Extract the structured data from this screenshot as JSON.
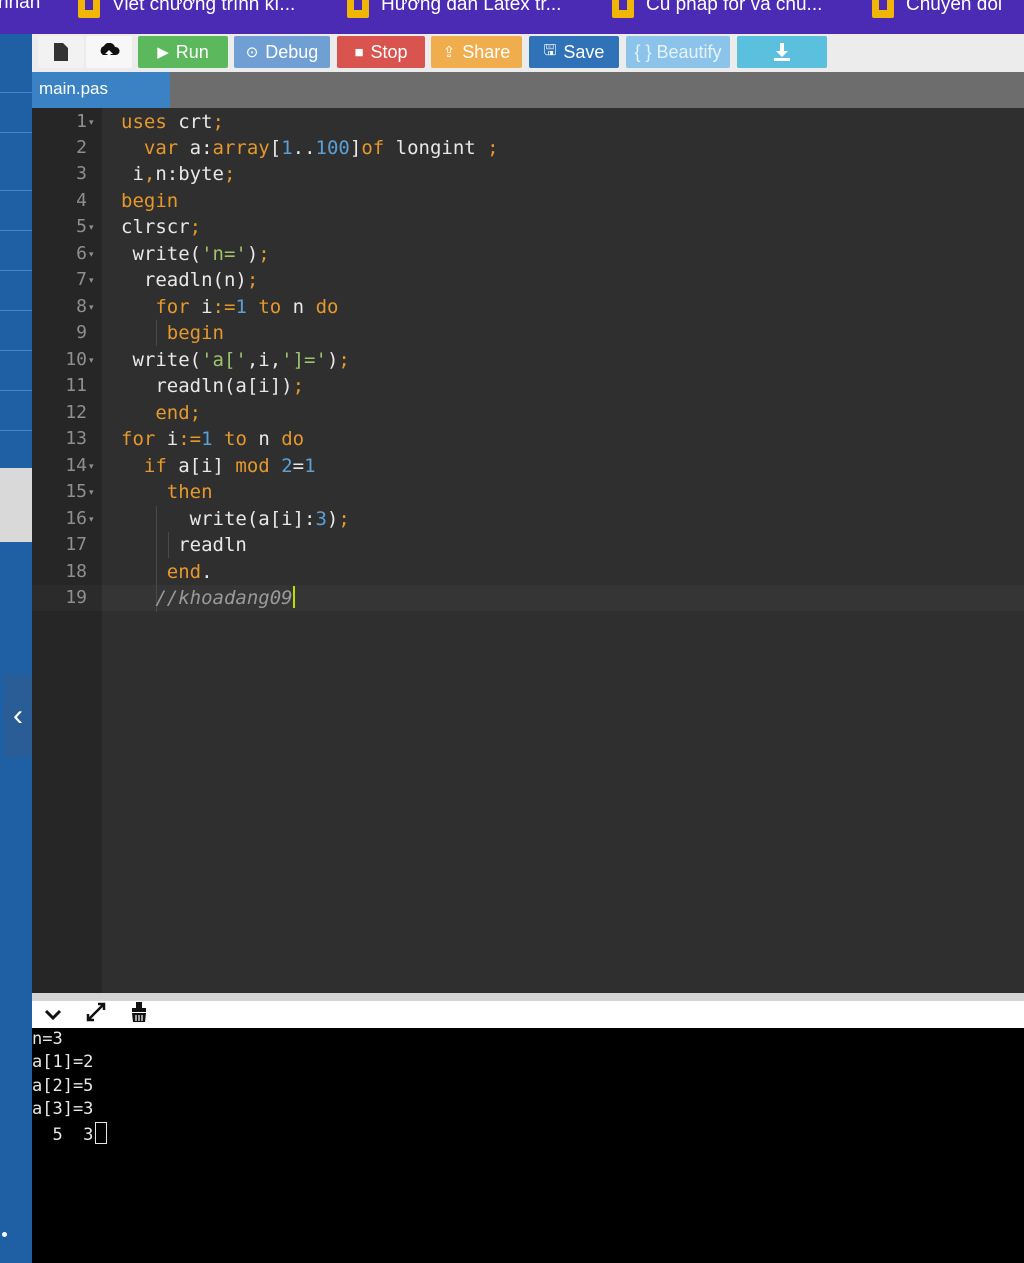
{
  "bookmarks": [
    {
      "label": "nhan"
    },
    {
      "label": "Viết chương trình kí..."
    },
    {
      "label": "Hướng dẫn Latex tr..."
    },
    {
      "label": "Cú pháp for và chu..."
    },
    {
      "label": "Chuyển đổi"
    }
  ],
  "toolbar": {
    "new_icon": "file-icon",
    "upload_icon": "upload-cloud-icon",
    "run_label": "Run",
    "debug_label": "Debug",
    "stop_label": "Stop",
    "share_label": "Share",
    "save_label": "Save",
    "beautify_label": "{ } Beautify",
    "download_icon": "download-icon",
    "colors": {
      "run": "#5cb85c",
      "debug": "#6f9fd3",
      "stop": "#d9534f",
      "share": "#f0ad4e",
      "save": "#2f72b8",
      "beautify": "#8bc3ea",
      "download": "#5bc0de"
    }
  },
  "tab": {
    "filename": "main.pas"
  },
  "editor": {
    "line_numbers": [
      "1",
      "2",
      "3",
      "4",
      "5",
      "6",
      "7",
      "8",
      "9",
      "10",
      "11",
      "12",
      "13",
      "14",
      "15",
      "16",
      "17",
      "18",
      "19"
    ],
    "fold_lines": [
      1,
      5,
      6,
      7,
      8,
      10,
      13,
      14,
      15
    ],
    "active_line": 19,
    "comment_text": "//khoadang09"
  },
  "output": {
    "collapse_icon": "chevron-down-icon",
    "expand_icon": "expand-icon",
    "clear_icon": "clear-icon",
    "lines": [
      "n=3",
      "a[1]=2",
      "a[2]=5",
      "a[3]=3",
      "  5  3"
    ]
  },
  "sidebar": {
    "collapse_icon": "chevron-left-icon"
  }
}
